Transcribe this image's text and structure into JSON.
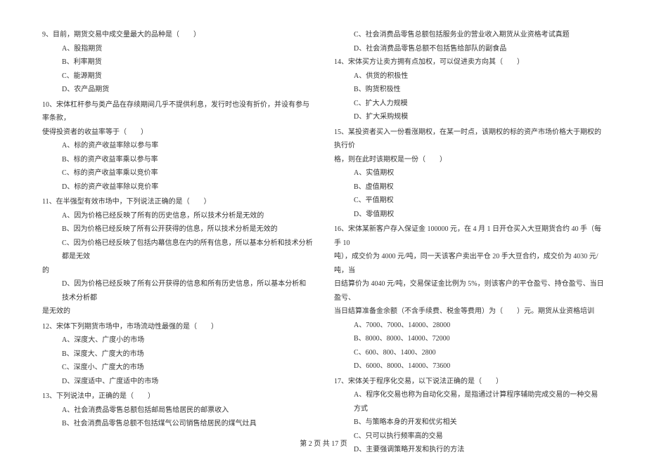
{
  "left": {
    "q9": {
      "text": "9、目前，期货交易中成交量最大的品种是（　　）",
      "a": "A、股指期货",
      "b": "B、利率期货",
      "c": "C、能源期货",
      "d": "D、农产品期货"
    },
    "q10": {
      "text": "10、宋体杠杆参与类产品在存续期间几乎不提供利息，发行时也没有折价，并设有参与率条款，",
      "cont": "使得投资者的收益率等于（　　）",
      "a": "A、标的资产收益率除以参与率",
      "b": "B、标的资产收益率乘以参与率",
      "c": "C、标的资产收益率乘以竞价率",
      "d": "D、标的资产收益率除以竞价率"
    },
    "q11": {
      "text": "11、在半强型有效市场中，下列说法正确的是（　　）",
      "a": "A、因为价格已经反映了所有的历史信息，所以技术分析是无效的",
      "b": "B、因为价格已经反映了所有公开获得的信息，所以技术分析是无效的",
      "c": "C、因为价格已经反映了包括内幕信息在内的所有信息，所以基本分析和技术分析都是无效",
      "c_cont": "的",
      "d": "D、因为价格已经反映了所有公开获得的信息和所有历史信息，所以基本分析和技术分析都",
      "d_cont": "是无效的"
    },
    "q12": {
      "text": "12、宋体下列期货市场中，市场流动性最强的是（　　）",
      "a": "A、深度大、广度小的市场",
      "b": "B、深度大、广度大的市场",
      "c": "C、深度小、广度大的市场",
      "d": "D、深度适中、广度适中的市场"
    },
    "q13": {
      "text": "13、下列说法中，正确的是（　　）",
      "a": "A、社会消费品零售总额包括邮局售给居民的邮票收入",
      "b": "B、社会消费品零售总额不包括煤气公司销售给居民的煤气灶具"
    }
  },
  "right": {
    "q13c": "C、社会消费品零售总额包括服务业的营业收入期货从业资格考试真题",
    "q13d": "D、社会消费品零售总额不包括售给部队的副食品",
    "q14": {
      "text": "14、宋体买方让卖方拥有点加权，可以促进卖方向其（　　）",
      "a": "A、供货的积极性",
      "b": "B、购货积极性",
      "c": "C、扩大人力规模",
      "d": "D、扩大采购规模"
    },
    "q15": {
      "text": "15、某投资者买入一份看涨期权，在某一时点，该期权的标的资产市场价格大于期权的执行价",
      "cont": "格，则在此时该期权是一份（　　）",
      "a": "A、实值期权",
      "b": "B、虚值期权",
      "c": "C、平值期权",
      "d": "D、零值期权"
    },
    "q16": {
      "text": "16、宋体某新客户存入保证金 100000 元，在 4 月 1 日开仓买入大豆期货合约 40 手（每手 10",
      "cont1": "吨），成交价为 4000 元/吨，同一天该客户卖出平仓 20 手大豆合约，成交价为 4030 元/吨，当",
      "cont2": "日结算价为 4040 元/吨，交易保证金比例为 5%，则该客户的平仓盈亏、持仓盈亏、当日盈亏、",
      "cont3": "当日结算准备金余额（不含手续费、税金等费用）为（　　）元。期货从业资格培训",
      "a": "A、7000、7000、14000、28000",
      "b": "B、8000、8000、14000、72000",
      "c": "C、600、800、1400、2800",
      "d": "D、6000、8000、14000、73600"
    },
    "q17": {
      "text": "17、宋体关于程序化交易，以下说法正确的是（　　）",
      "a": "A、程序化交易也称为自动化交易，是指通过计算程序辅助完成交易的一种交易方式",
      "b": "B、与策略本身的开发和优劣相关",
      "c": "C、只可以执行频率高的交易",
      "d": "D、主要强调策略开发和执行的方法"
    }
  },
  "footer": "第 2 页 共 17 页"
}
